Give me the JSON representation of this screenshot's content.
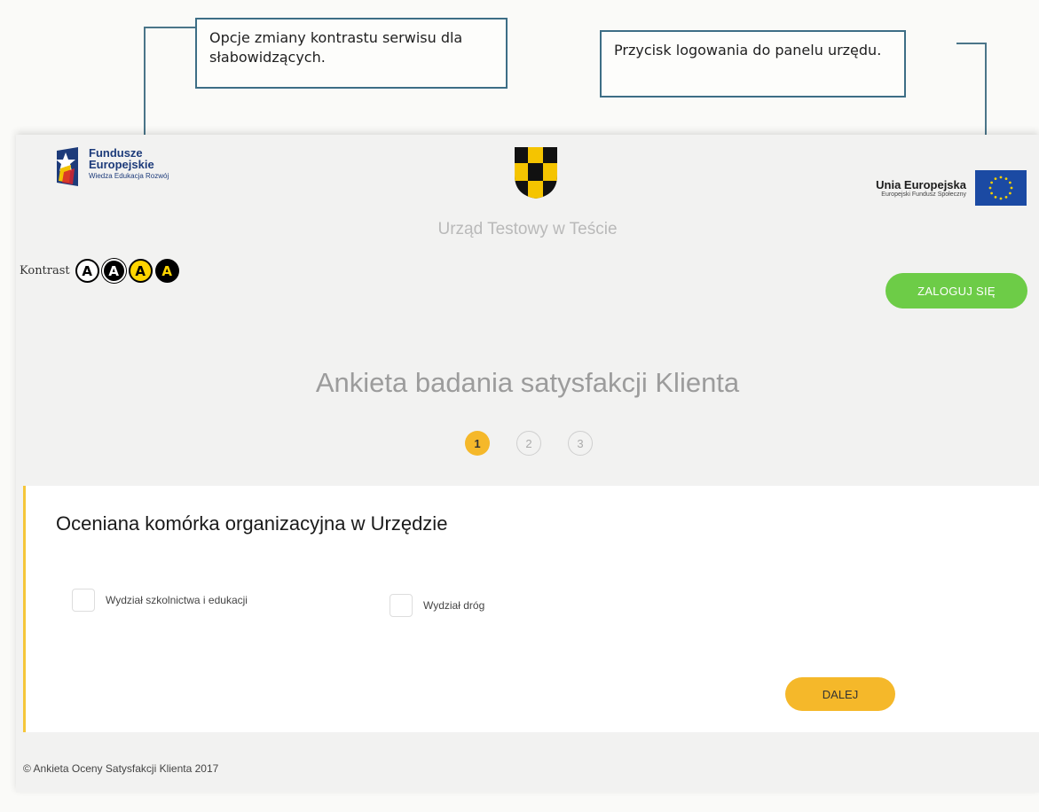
{
  "annotations": {
    "contrast_note": "Opcje zmiany kontrastu serwisu dla słabowidzących.",
    "login_note": "Przycisk logowania do panelu urzędu."
  },
  "header": {
    "fe_logo_title_1": "Fundusze",
    "fe_logo_title_2": "Europejskie",
    "fe_logo_subtitle": "Wiedza Edukacja Rozwój",
    "ue_logo_title": "Unia Europejska",
    "ue_logo_subtitle": "Europejski Fundusz Społeczny",
    "office_name": "Urząd Testowy w Teście"
  },
  "contrast": {
    "label": "Kontrast",
    "options": [
      "A",
      "A",
      "A",
      "A"
    ]
  },
  "login_button": "ZALOGUJ SIĘ",
  "survey": {
    "title": "Ankieta badania satysfakcji Klienta",
    "steps": [
      "1",
      "2",
      "3"
    ],
    "active_step": 1,
    "question": "Oceniana komórka organizacyjna w Urzędzie",
    "options": [
      "Wydział szkolnictwa i edukacji",
      "Wydział dróg"
    ],
    "next_button": "DALEJ"
  },
  "footer": "© Ankieta Oceny Satysfakcji Klienta 2017",
  "colors": {
    "login_green": "#6dcc47",
    "accent_yellow": "#f5b82a",
    "callout_border": "#3d6e86"
  }
}
